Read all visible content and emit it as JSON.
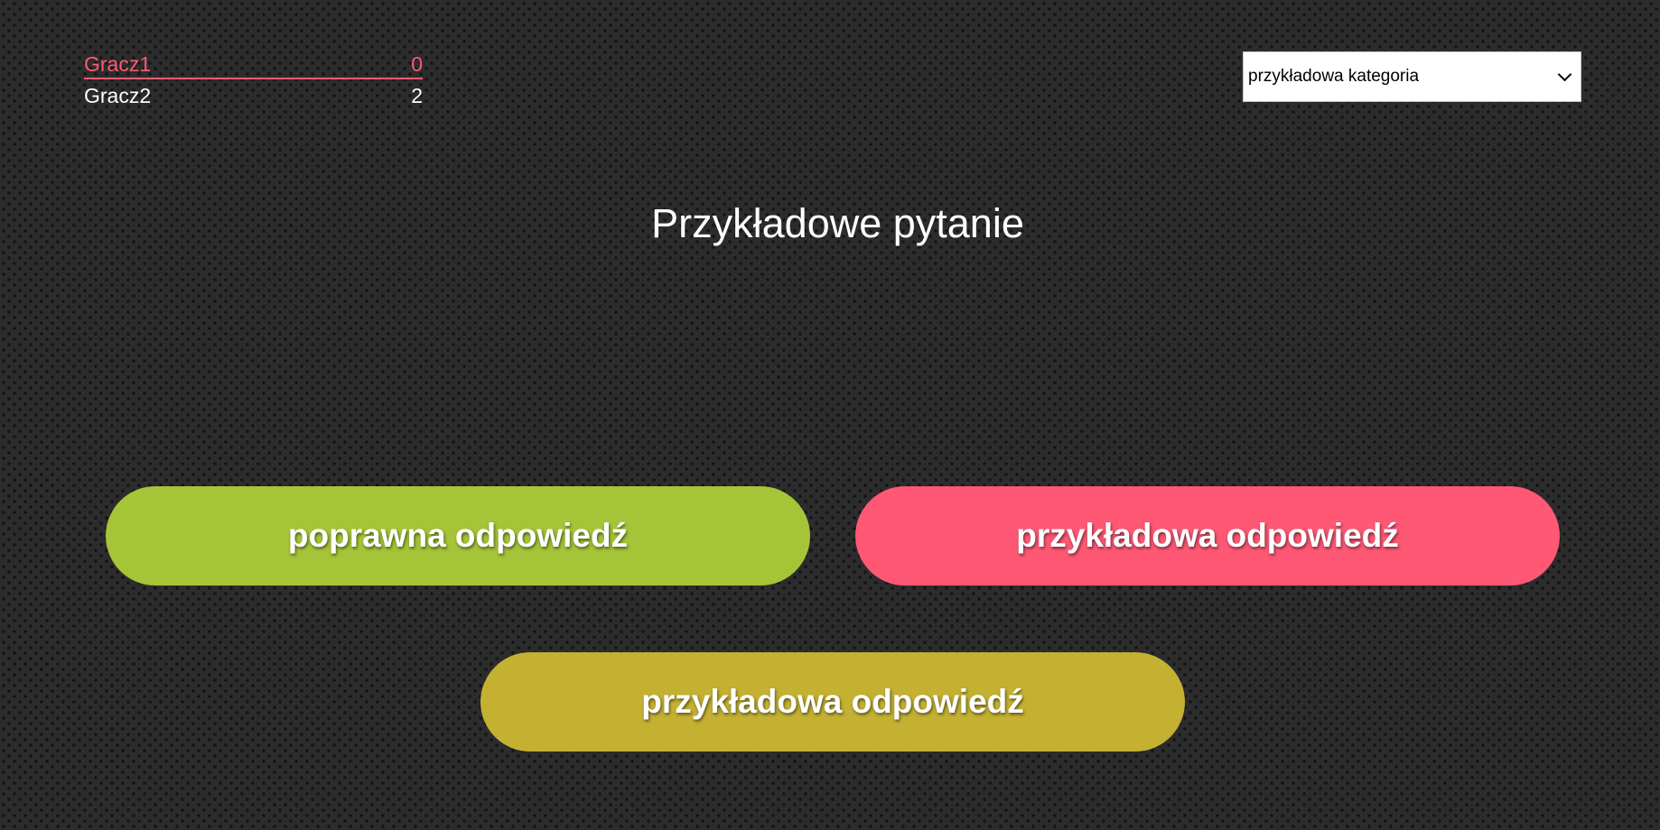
{
  "scoreboard": {
    "players": [
      {
        "name": "Gracz1",
        "score": "0",
        "active": true
      },
      {
        "name": "Gracz2",
        "score": "2",
        "active": false
      }
    ]
  },
  "category": {
    "selected": "przykładowa kategoria"
  },
  "question": {
    "text": "Przykładowe pytanie"
  },
  "answers": [
    {
      "label": "poprawna odpowiedź",
      "color": "#a6c437"
    },
    {
      "label": "przykładowa odpowiedź",
      "color": "#fe5875"
    },
    {
      "label": "przykładowa odpowiedź",
      "color": "#c4b132"
    }
  ],
  "colors": {
    "active_player": "#ff5a73",
    "background": "#2c2c2c"
  },
  "icons": {
    "category_dropdown": "chevron-down-icon"
  }
}
